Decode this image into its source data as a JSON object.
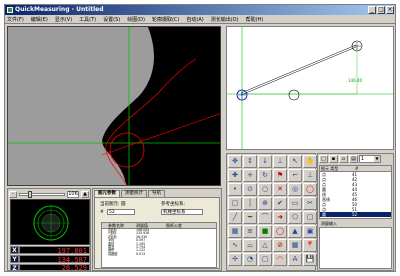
{
  "window": {
    "title": "QuickMeasuring - Untitled"
  },
  "menu": [
    "文件(F)",
    "编辑(E)",
    "显示(V)",
    "工具(T)",
    "设置(S)",
    "绘图(D)",
    "轮廓摄取(C)",
    "自动(A)",
    "测长输出(O)",
    "帮助(H)"
  ],
  "mini_panel": {
    "zoom_value": "106"
  },
  "readouts": {
    "x": "197.801",
    "y": "134.587",
    "z": "26.529"
  },
  "params": {
    "tabs": [
      "图元参数",
      "测量统计",
      "导航"
    ],
    "current_element_label": "当前图元:",
    "current_element_value": "圆",
    "reference_label": "参考坐标系:",
    "reference_value": "机械坐标系",
    "num_label": "#",
    "num_value": "52",
    "table_headers": [
      "参数名称",
      "测量值",
      "图纸公差"
    ],
    "rows": [
      [
        "X坐标",
        "198.004",
        ""
      ],
      [
        "Y坐标",
        "133.928",
        ""
      ],
      [
        "Z坐标",
        "26.530",
        ""
      ],
      [
        "半径",
        "0.597",
        ""
      ],
      [
        "直径",
        "1.195",
        ""
      ],
      [
        "周长",
        "3.754",
        ""
      ],
      [
        "面积",
        "1.122",
        ""
      ],
      [
        "真圆度",
        "0.013",
        ""
      ]
    ]
  },
  "elements": {
    "combo_value": "1",
    "headers": [
      "图元 类型",
      "#"
    ],
    "rows": [
      [
        "点",
        "41"
      ],
      [
        "点",
        "42"
      ],
      [
        "点",
        "43"
      ],
      [
        "圆",
        "44"
      ],
      [
        "线",
        "45"
      ],
      [
        "直线",
        "46"
      ],
      [
        "点",
        "50"
      ],
      [
        "点",
        "51"
      ],
      [
        "圆",
        "52"
      ]
    ],
    "selected_index": 8,
    "coord_label": "测量输入"
  },
  "drawing": {
    "dimension_text": "146.40"
  },
  "colors": {
    "title_bar": "#0a246a",
    "readout_text": "#ff3030",
    "overlay_red": "#ff0000",
    "overlay_green": "#00c000"
  },
  "toolbar_icons": [
    "move-arrows-icon",
    "vertical-move-icon",
    "down-arrow-icon",
    "align-icon",
    "pointer-icon",
    "hand-icon",
    "cross-icon",
    "plus-icon",
    "rotate-icon",
    "red-flag-icon",
    "corner-icon",
    "perpendicular-icon",
    "point-icon",
    "measure-point-icon",
    "circle-tool-icon",
    "red-x-icon",
    "circle-select-icon",
    "red-circle-icon",
    "box-icon",
    "vertical-line-icon",
    "target-icon",
    "check-icon",
    "rectangle-icon",
    "cut-icon",
    "line-tool-icon",
    "green-line-icon",
    "arc-icon",
    "red-arrow-icon",
    "polygon-icon",
    "rounded-rect-icon",
    "grid-icon",
    "stack-icon",
    "green-square-icon",
    "red-ring-icon",
    "chart-icon",
    "folder-icon",
    "sine-icon",
    "arc-dim-icon",
    "triangle-icon",
    "no-entry-icon",
    "grid-small-icon",
    "pin-icon",
    "move-icon",
    "gauge-icon",
    "frame-icon",
    "red-arc-icon",
    "text-icon",
    "save-icon"
  ]
}
